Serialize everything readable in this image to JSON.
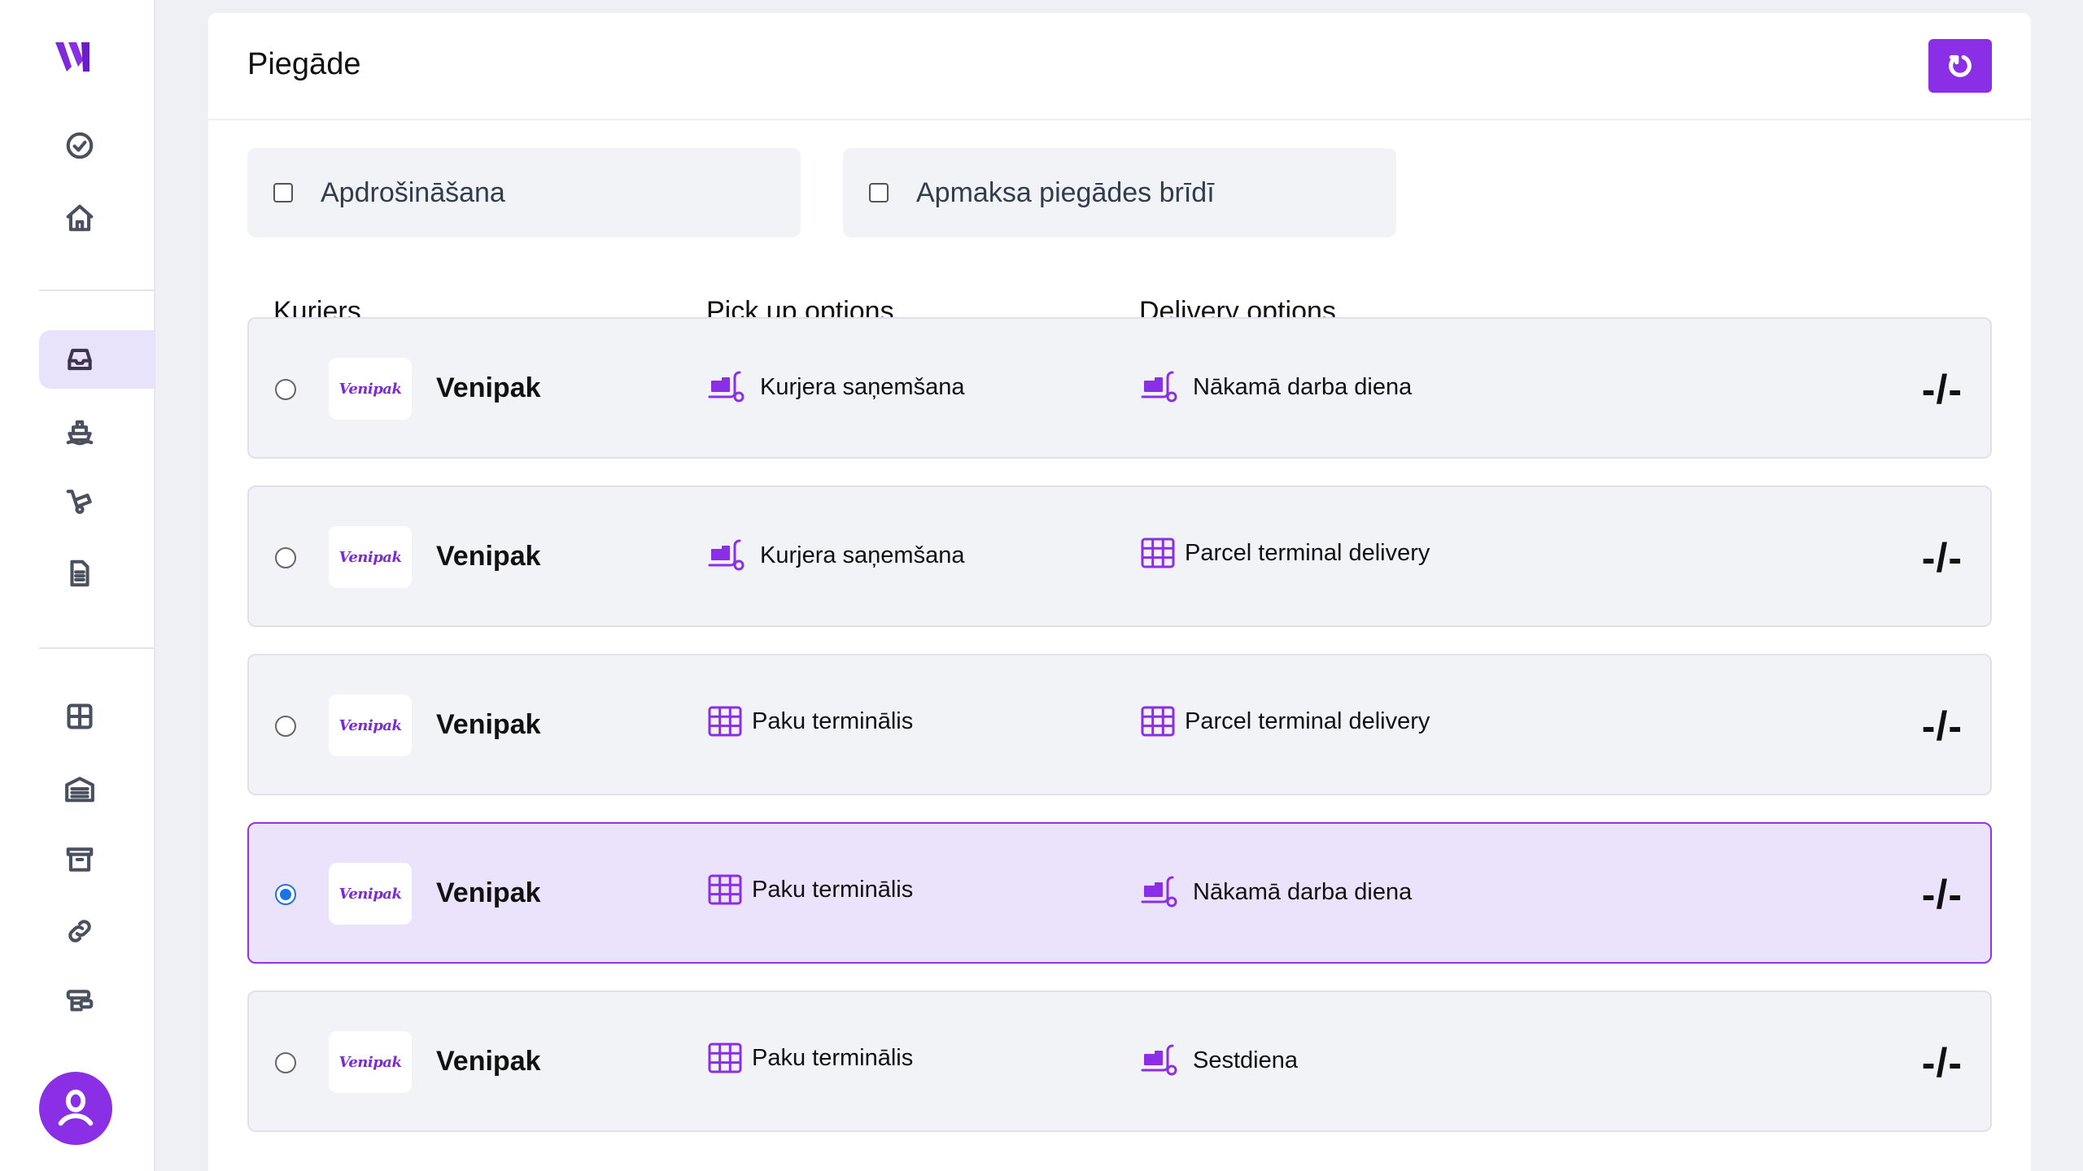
{
  "sidebar": {
    "logo_icon": "venipak-v-logo",
    "items": [
      {
        "icon": "check-circle-icon",
        "active": false
      },
      {
        "icon": "home-icon",
        "active": false
      },
      {
        "icon": "inbox-icon",
        "active": true
      },
      {
        "icon": "ship-icon",
        "active": false
      },
      {
        "icon": "hand-truck-icon",
        "active": false
      },
      {
        "icon": "document-icon",
        "active": false
      },
      {
        "icon": "grid-icon",
        "active": false
      },
      {
        "icon": "warehouse-icon",
        "active": false
      },
      {
        "icon": "archive-icon",
        "active": false
      },
      {
        "icon": "link-icon",
        "active": false
      },
      {
        "icon": "layers-icon",
        "active": false
      }
    ],
    "avatar_icon": "user-icon"
  },
  "card": {
    "title": "Piegāde",
    "refresh_icon": "refresh-icon"
  },
  "options": {
    "insurance_label": "Apdrošināšana",
    "cod_label": "Apmaksa piegādes brīdī"
  },
  "columns": {
    "courier": "Kurjers",
    "pickup": "Pick up options",
    "delivery": "Delivery options"
  },
  "rows": [
    {
      "logo_text": "Venipak",
      "name": "Venipak",
      "pickup": "Kurjera saņemšana",
      "pickup_icon": "truck",
      "delivery": "Nākamā darba diena",
      "delivery_icon": "truck",
      "price": "-/-",
      "selected": false
    },
    {
      "logo_text": "Venipak",
      "name": "Venipak",
      "pickup": "Kurjera saņemšana",
      "pickup_icon": "truck",
      "delivery": "Parcel terminal delivery",
      "delivery_icon": "grid",
      "price": "-/-",
      "selected": false
    },
    {
      "logo_text": "Venipak",
      "name": "Venipak",
      "pickup": "Paku terminālis",
      "pickup_icon": "grid",
      "delivery": "Parcel terminal delivery",
      "delivery_icon": "grid",
      "price": "-/-",
      "selected": false
    },
    {
      "logo_text": "Venipak",
      "name": "Venipak",
      "pickup": "Paku terminālis",
      "pickup_icon": "grid",
      "delivery": "Nākamā darba diena",
      "delivery_icon": "truck",
      "price": "-/-",
      "selected": true
    },
    {
      "logo_text": "Venipak",
      "name": "Venipak",
      "pickup": "Paku terminālis",
      "pickup_icon": "grid",
      "delivery": "Sestdiena",
      "delivery_icon": "truck",
      "price": "-/-",
      "selected": false
    }
  ],
  "colors": {
    "accent": "#8b2fe6",
    "selected_row_bg": "#ebe3fb",
    "selected_row_border": "#9333ea",
    "row_bg": "#f2f3f6"
  }
}
